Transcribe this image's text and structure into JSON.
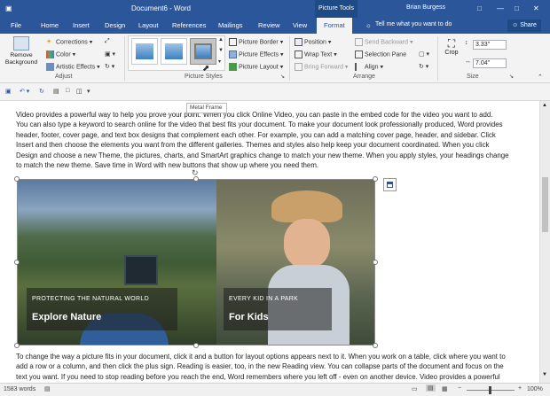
{
  "window": {
    "title": "Document6 - Word",
    "context_tab_group": "Picture Tools",
    "user": "Brian Burgess"
  },
  "tabs": [
    {
      "label": "File",
      "active": false
    },
    {
      "label": "Home",
      "active": false
    },
    {
      "label": "Insert",
      "active": false
    },
    {
      "label": "Design",
      "active": false
    },
    {
      "label": "Layout",
      "active": false
    },
    {
      "label": "References",
      "active": false
    },
    {
      "label": "Mailings",
      "active": false
    },
    {
      "label": "Review",
      "active": false
    },
    {
      "label": "View",
      "active": false
    },
    {
      "label": "Format",
      "active": true
    }
  ],
  "tell_me": "Tell me what you want to do",
  "share_label": "Share",
  "ribbon": {
    "adjust": {
      "label": "Adjust",
      "remove_bg": "Remove Background",
      "corrections": "Corrections",
      "color": "Color",
      "artistic": "Artistic Effects"
    },
    "picture_styles": {
      "label": "Picture Styles",
      "border": "Picture Border",
      "effects": "Picture Effects",
      "layout": "Picture Layout"
    },
    "arrange": {
      "label": "Arrange",
      "position": "Position",
      "wrap_text": "Wrap Text",
      "bring_forward": "Bring Forward",
      "send_backward": "Send Backward",
      "selection_pane": "Selection Pane",
      "align": "Align"
    },
    "size": {
      "label": "Size",
      "crop": "Crop",
      "height": "3.33\"",
      "width": "7.04\""
    }
  },
  "tooltip": "Metal Frame",
  "document": {
    "para1_lines": [
      "Video provides a powerful way to help you prove your point. When you click Online Video, you can paste in the embed code for the video you want to add.",
      "You can also type a keyword to search online for the video that best fits your document. To make your document look professionally produced, Word provides",
      "header, footer, cover page, and text box designs that complement each other. For example, you can add a matching cover page, header, and sidebar. Click",
      "Insert and then choose the elements you want from the different galleries. Themes and styles also help keep your document coordinated. When you click",
      "Design and choose a new Theme, the pictures, charts, and SmartArt graphics change to match your new theme. When you apply styles, your headings change",
      "to match the new theme. Save time in Word with new buttons that show up where you need them."
    ],
    "picture": {
      "left_small": "PROTECTING THE NATURAL WORLD",
      "left_big": "Explore Nature",
      "right_small": "EVERY KID IN A PARK",
      "right_big": "For Kids"
    },
    "para2_lines": [
      "To change the way a picture fits in your document, click it and a button for layout options appears next to it. When you work on a table, click where you want to",
      "add a row or a column, and then click the plus sign. Reading is easier, too, in the new Reading view. You can collapse parts of the document and focus on the",
      "text you want. If you need to stop reading before you reach the end, Word remembers where you left off - even on another device. Video provides a powerful"
    ]
  },
  "status": {
    "words": "1583 words",
    "zoom": "100%"
  },
  "colors": {
    "accent": "#2b579a"
  }
}
